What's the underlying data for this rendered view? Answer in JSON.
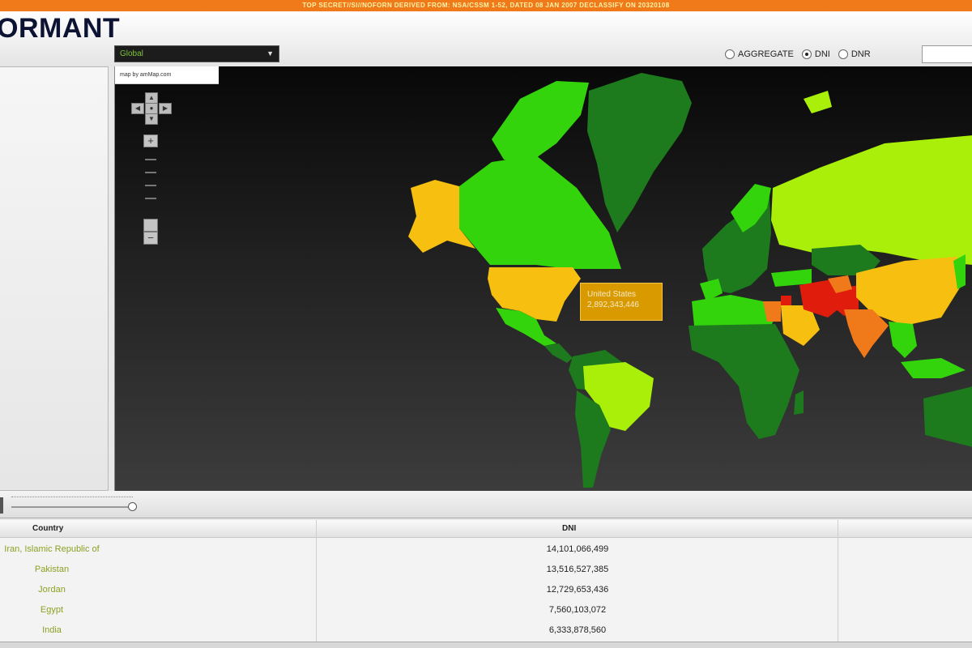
{
  "classification_banner": "TOP SECRET//SI//NOFORN DERIVED FROM: NSA/CSSM 1-52, DATED 08 JAN 2007 DECLASSIFY ON 20320108",
  "app": {
    "title": "ORMANT"
  },
  "controls": {
    "region_select": {
      "value": "Global"
    },
    "metric_options": [
      {
        "label": "AGGREGATE",
        "selected": false
      },
      {
        "label": "DNI",
        "selected": true
      },
      {
        "label": "DNR",
        "selected": false
      }
    ]
  },
  "map": {
    "credit": "map by amMap.com",
    "tooltip": {
      "country": "United States",
      "value": "2,892,343,446"
    },
    "icons": [
      "pan-up-icon",
      "pan-left-icon",
      "pan-home-icon",
      "pan-right-icon",
      "pan-down-icon",
      "zoom-in-icon",
      "zoom-out-icon"
    ],
    "colors": {
      "ocean": "#1a1a1a",
      "highest": "#e01c0c",
      "high": "#f07a1a",
      "medium": "#f7c010",
      "low": "#aaef0a",
      "lower": "#33d40c",
      "lowest": "#1d7a1d"
    }
  },
  "table": {
    "headers": {
      "country": "Country",
      "metric": "DNI"
    },
    "rows": [
      {
        "country": "Iran, Islamic Republic of",
        "value": "14,101,066,499"
      },
      {
        "country": "Pakistan",
        "value": "13,516,527,385"
      },
      {
        "country": "Jordan",
        "value": "12,729,653,436"
      },
      {
        "country": "Egypt",
        "value": "7,560,103,072"
      },
      {
        "country": "India",
        "value": "6,333,878,560"
      }
    ]
  }
}
